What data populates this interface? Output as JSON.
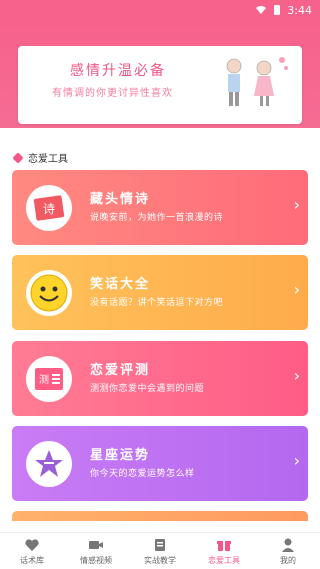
{
  "status_bar": {
    "time": "3:44"
  },
  "banner": {
    "title": "感情升温必备",
    "subtitle": "有情调的你更讨异性喜欢"
  },
  "section": {
    "title": "恋爱工具"
  },
  "cards": [
    {
      "title": "藏头情诗",
      "desc": "说晚安前，为她作一首浪漫的诗",
      "icon": "poem-icon",
      "badge": "诗"
    },
    {
      "title": "笑话大全",
      "desc": "没有话题？讲个笑话逗下对方吧",
      "icon": "smiley-icon"
    },
    {
      "title": "恋爱评测",
      "desc": "测测你恋爱中会遇到的问题",
      "icon": "test-icon",
      "badge": "测"
    },
    {
      "title": "星座运势",
      "desc": "你今天的恋爱运势怎么样",
      "icon": "star-icon"
    }
  ],
  "tabs": [
    {
      "label": "话术库",
      "icon": "hearts-icon"
    },
    {
      "label": "情感视频",
      "icon": "video-icon"
    },
    {
      "label": "实战教学",
      "icon": "book-icon"
    },
    {
      "label": "恋爱工具",
      "icon": "gift-icon",
      "active": true
    },
    {
      "label": "我的",
      "icon": "user-icon"
    }
  ],
  "colors": {
    "accent": "#f25786",
    "header": "#f7628b"
  }
}
